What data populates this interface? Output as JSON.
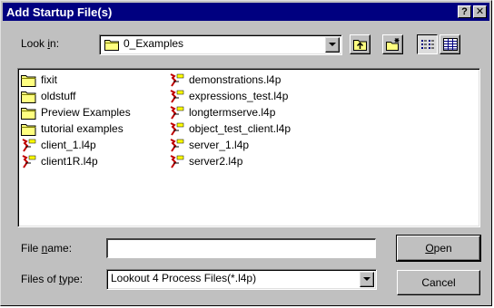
{
  "window": {
    "title": "Add Startup File(s)",
    "help_glyph": "?",
    "close_glyph": "✕"
  },
  "look_in": {
    "label_pre": "Look ",
    "label_key": "i",
    "label_post": "n:",
    "value": "0_Examples"
  },
  "toolbar": {
    "icons": [
      "up-one-level-icon",
      "create-new-folder-icon",
      "list-view-icon",
      "details-view-icon"
    ]
  },
  "files": {
    "column1": [
      {
        "name": "fixit",
        "icon": "folder"
      },
      {
        "name": "oldstuff",
        "icon": "folder"
      },
      {
        "name": "Preview Examples",
        "icon": "folder"
      },
      {
        "name": "tutorial examples",
        "icon": "folder"
      },
      {
        "name": "client_1.l4p",
        "icon": "process-file"
      },
      {
        "name": "client1R.l4p",
        "icon": "process-file"
      }
    ],
    "column2": [
      {
        "name": "demonstrations.l4p",
        "icon": "process-file"
      },
      {
        "name": "expressions_test.l4p",
        "icon": "process-file"
      },
      {
        "name": "longtermserve.l4p",
        "icon": "process-file"
      },
      {
        "name": "object_test_client.l4p",
        "icon": "process-file"
      },
      {
        "name": "server_1.l4p",
        "icon": "process-file"
      },
      {
        "name": "server2.l4p",
        "icon": "process-file"
      }
    ]
  },
  "file_name": {
    "label_pre": "File ",
    "label_key": "n",
    "label_post": "ame:",
    "value": ""
  },
  "file_type": {
    "label_pre": "Files of ",
    "label_key": "t",
    "label_post": "ype:",
    "value": "Lookout 4 Process Files(*.l4p)"
  },
  "buttons": {
    "open_key": "O",
    "open_rest": "pen",
    "cancel": "Cancel"
  },
  "colors": {
    "titlebar": "#000080",
    "face": "#c0c0c0",
    "folder": "#ffff80"
  }
}
